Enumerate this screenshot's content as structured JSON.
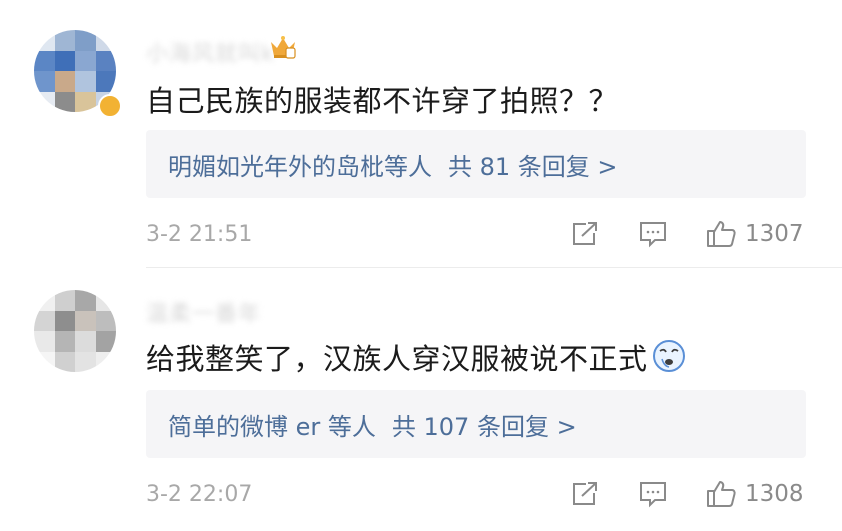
{
  "comments": [
    {
      "username": "小海风就叫k",
      "content": "自己民族的服装都不许穿了拍照？？",
      "reply_names": "明媚如光年外的岛枇等人",
      "reply_count": "共 81 条回复 >",
      "timestamp": "3-2 21:51",
      "likes": "1307",
      "icons": [
        "share-icon",
        "comment-icon",
        "like-icon",
        "crown-badge-icon"
      ]
    },
    {
      "username": "温柔一番年",
      "content": "给我整笑了，汉族人穿汉服被说不正式",
      "reply_names": "简单的微博 er 等人",
      "reply_count": "共 107 条回复 >",
      "timestamp": "3-2 22:07",
      "likes": "1308",
      "icons": [
        "share-icon",
        "comment-icon",
        "like-icon",
        "dizzy-face-emoji-icon"
      ]
    }
  ],
  "colors": {
    "link": "#4d6e99",
    "text": "#1b1b1b",
    "meta": "#a8a8a8",
    "reply_bg": "#f5f5f7",
    "badge": "#f2b233"
  }
}
